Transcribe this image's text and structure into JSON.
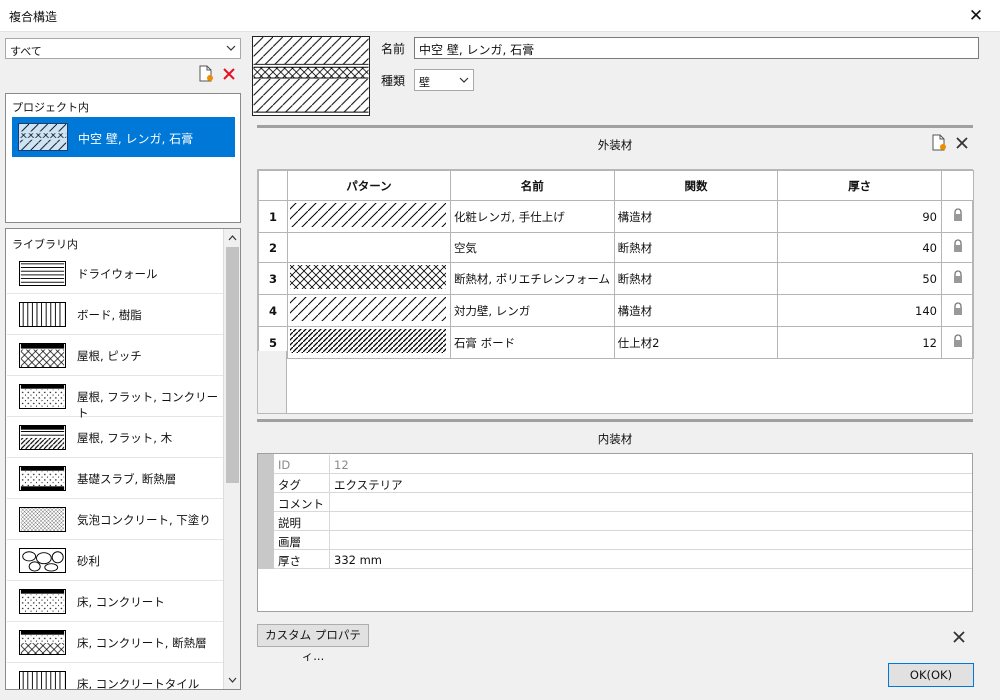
{
  "window": {
    "title": "複合構造"
  },
  "left": {
    "filter_value": "すべて",
    "project_header": "プロジェクト内",
    "project_selected": "中空 壁, レンガ, 石膏",
    "library_header": "ライブラリ内",
    "library_items": [
      "ドライウォール",
      "ボード, 樹脂",
      "屋根, ピッチ",
      "屋根, フラット, コンクリート",
      "屋根, フラット, 木",
      "基礎スラブ, 断熱層",
      "気泡コンクリート, 下塗り",
      "砂利",
      "床, コンクリート",
      "床, コンクリート, 断熱層",
      "床, コンクリートタイル"
    ]
  },
  "header": {
    "name_label": "名前",
    "name_value": "中空 壁, レンガ, 石膏",
    "type_label": "種類",
    "type_value": "壁"
  },
  "exterior": {
    "title": "外装材",
    "columns": [
      "パターン",
      "名前",
      "関数",
      "厚さ"
    ],
    "rows": [
      {
        "num": "1",
        "name": "化粧レンガ, 手仕上げ",
        "func": "構造材",
        "thick": "90"
      },
      {
        "num": "2",
        "name": "空気",
        "func": "断熱材",
        "thick": "40"
      },
      {
        "num": "3",
        "name": "断熱材, ポリエチレンフォーム",
        "func": "断熱材",
        "thick": "50"
      },
      {
        "num": "4",
        "name": "対力壁, レンガ",
        "func": "構造材",
        "thick": "140"
      },
      {
        "num": "5",
        "name": "石膏 ボード",
        "func": "仕上材2",
        "thick": "12"
      }
    ]
  },
  "interior": {
    "title": "内装材"
  },
  "props": [
    {
      "k": "ID",
      "v": "12"
    },
    {
      "k": "タグ",
      "v": "エクステリア"
    },
    {
      "k": "コメント",
      "v": ""
    },
    {
      "k": "説明",
      "v": ""
    },
    {
      "k": "画層",
      "v": ""
    },
    {
      "k": "厚さ",
      "v": "332 mm"
    }
  ],
  "buttons": {
    "custom": "カスタム プロパティ...",
    "ok": "OK(OK)"
  },
  "colors": {
    "selection": "#0078d7",
    "delete": "#e81123",
    "doc_accent": "#f08c00"
  }
}
